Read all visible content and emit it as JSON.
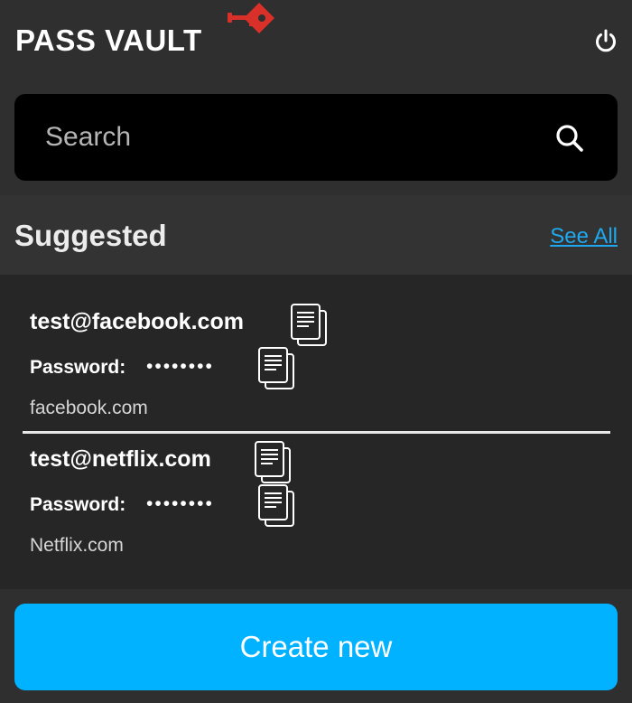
{
  "header": {
    "title": "PASS VAULT",
    "logo_icon": "key-shield-logo",
    "power_icon": "power-icon"
  },
  "search": {
    "placeholder": "Search",
    "value": "",
    "icon": "search-icon"
  },
  "suggested": {
    "title": "Suggested",
    "see_all": "See All"
  },
  "entries": [
    {
      "username": "test@facebook.com",
      "password_label": "Password:",
      "password_mask": "••••••••",
      "site": "facebook.com"
    },
    {
      "username": "test@netflix.com",
      "password_label": "Password:",
      "password_mask": "••••••••",
      "site": "Netflix.com"
    }
  ],
  "footer": {
    "create_label": "Create new"
  },
  "colors": {
    "background": "#2f2f2f",
    "accent": "#00b2ff",
    "link": "#1ea8ef",
    "logo": "#d9302a"
  }
}
